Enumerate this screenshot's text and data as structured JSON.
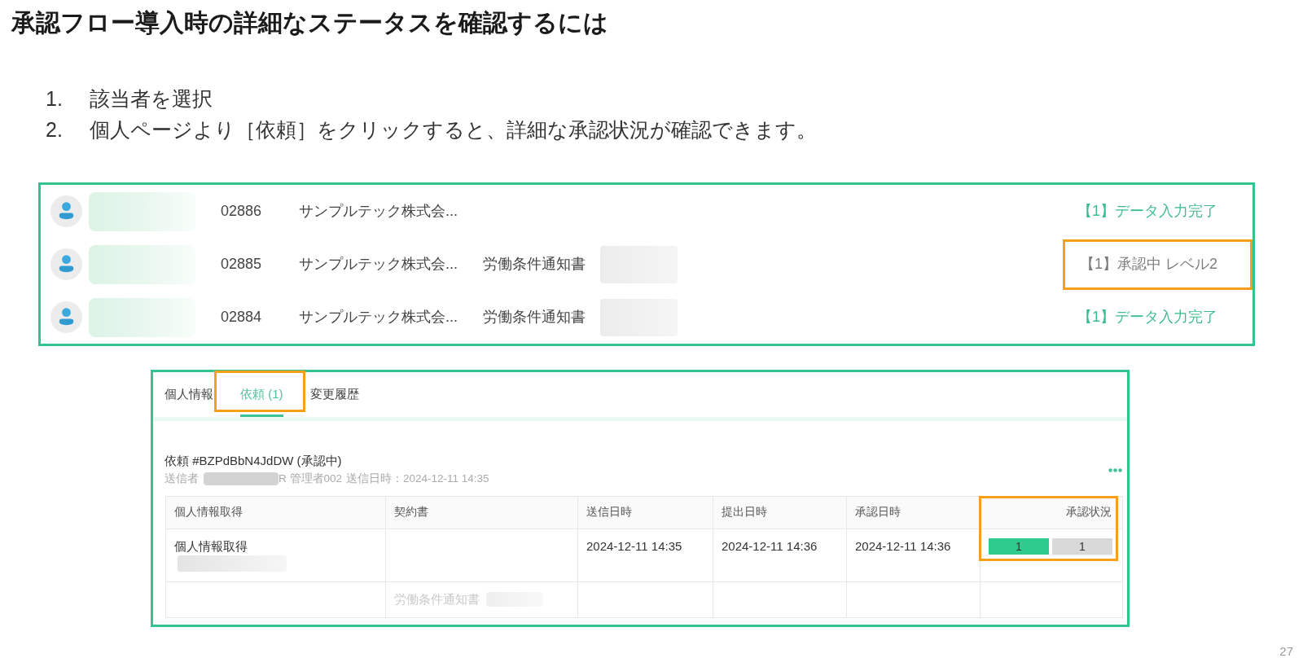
{
  "title": "承認フロー導入時の詳細なステータスを確認するには",
  "steps": [
    {
      "number": "1.",
      "text": "該当者を選択"
    },
    {
      "number": "2.",
      "text": "個人ページより［依頼］をクリックすると、詳細な承認状況が確認できます。"
    }
  ],
  "employee_list": {
    "rows": [
      {
        "id": "02886",
        "company": "サンプルテック株式会...",
        "status": "【1】データ入力完了",
        "color": "#3dbd8d",
        "highlighted": false
      },
      {
        "id": "02885",
        "company": "サンプルテック株式会...",
        "document": "労働条件通知書",
        "status": "【1】承認中 レベル2",
        "color": "#7d7d7d",
        "highlighted": true
      },
      {
        "id": "02884",
        "company": "サンプルテック株式会...",
        "document": "労働条件通知書",
        "status": "【1】データ入力完了",
        "color": "#3dbd8d",
        "highlighted": false
      }
    ]
  },
  "detail_panel": {
    "tabs": [
      {
        "label": "個人情報",
        "selected": false,
        "highlighted": false
      },
      {
        "label": "依頼 (1)",
        "selected": true,
        "highlighted": true
      },
      {
        "label": "変更履歴",
        "selected": false,
        "highlighted": false
      }
    ],
    "request": {
      "title": "依頼 #BZPdBbN4JdDW (承認中)",
      "sender_label": "送信者",
      "sender_name": "R 管理者002",
      "sent_at": "送信日時：2024-12-11 14:35"
    },
    "table": {
      "columns": [
        {
          "label": "個人情報取得",
          "highlighted": false
        },
        {
          "label": "契約書",
          "highlighted": false
        },
        {
          "label": "送信日時",
          "highlighted": false
        },
        {
          "label": "提出日時",
          "highlighted": false
        },
        {
          "label": "承認日時",
          "highlighted": false
        },
        {
          "label": "承認状況",
          "highlighted": true
        }
      ],
      "rows": [
        {
          "disabled": false,
          "cells": [
            {
              "kind": "stacked",
              "text": "個人情報取得",
              "redacted": true
            },
            null,
            {
              "kind": "text",
              "text": "2024-12-11 14:35"
            },
            {
              "kind": "text",
              "text": "2024-12-11 14:36"
            },
            {
              "kind": "text",
              "text": "2024-12-11 14:36"
            },
            {
              "kind": "steps",
              "steps": [
                {
                  "label": "1",
                  "done": true
                },
                {
                  "label": "1",
                  "done": false
                }
              ]
            }
          ]
        },
        {
          "disabled": true,
          "cells": [
            null,
            {
              "kind": "text",
              "text": "労働条件通知書",
              "redacted": true
            },
            null,
            null,
            null,
            null
          ]
        }
      ]
    }
  },
  "page_number": "27"
}
